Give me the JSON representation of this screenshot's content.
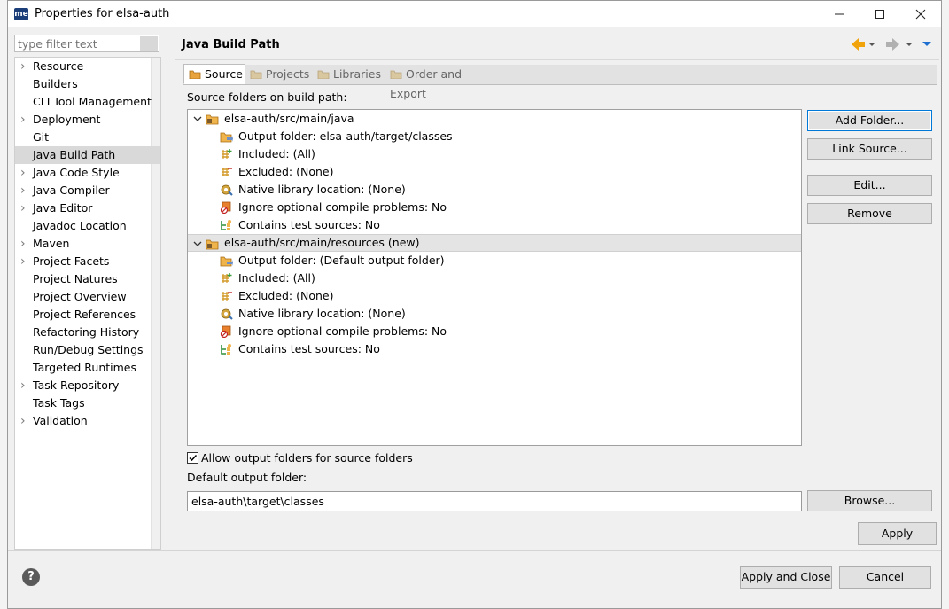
{
  "window": {
    "app_icon": "me",
    "title": "Properties for elsa-auth",
    "minimize_icon": "minimize-icon",
    "maximize_icon": "maximize-icon",
    "close_icon": "close-icon"
  },
  "filter": {
    "placeholder": "type filter text"
  },
  "nav": {
    "items": [
      {
        "label": "Resource",
        "expandable": true
      },
      {
        "label": "Builders",
        "expandable": false
      },
      {
        "label": "CLI Tool Management",
        "expandable": false
      },
      {
        "label": "Deployment",
        "expandable": true
      },
      {
        "label": "Git",
        "expandable": false
      },
      {
        "label": "Java Build Path",
        "expandable": false,
        "selected": true
      },
      {
        "label": "Java Code Style",
        "expandable": true
      },
      {
        "label": "Java Compiler",
        "expandable": true
      },
      {
        "label": "Java Editor",
        "expandable": true
      },
      {
        "label": "Javadoc Location",
        "expandable": false
      },
      {
        "label": "Maven",
        "expandable": true
      },
      {
        "label": "Project Facets",
        "expandable": true
      },
      {
        "label": "Project Natures",
        "expandable": false
      },
      {
        "label": "Project Overview",
        "expandable": false
      },
      {
        "label": "Project References",
        "expandable": false
      },
      {
        "label": "Refactoring History",
        "expandable": false
      },
      {
        "label": "Run/Debug Settings",
        "expandable": false
      },
      {
        "label": "Targeted Runtimes",
        "expandable": false
      },
      {
        "label": "Task Repository",
        "expandable": true
      },
      {
        "label": "Task Tags",
        "expandable": false
      },
      {
        "label": "Validation",
        "expandable": true
      }
    ]
  },
  "page": {
    "title": "Java Build Path",
    "tabs": [
      {
        "label": "Source",
        "active": true
      },
      {
        "label": "Projects",
        "active": false
      },
      {
        "label": "Libraries",
        "active": false
      },
      {
        "label": "Order and Export",
        "active": false
      }
    ],
    "source_label": "Source folders on build path:",
    "tree": [
      {
        "text": "elsa-auth/src/main/java",
        "level": 0,
        "icon": "package-folder-icon",
        "expanded": true
      },
      {
        "text": "Output folder: elsa-auth/target/classes",
        "level": 1,
        "icon": "output-folder-icon"
      },
      {
        "text": "Included: (All)",
        "level": 1,
        "icon": "inclusion-filter-icon"
      },
      {
        "text": "Excluded: (None)",
        "level": 1,
        "icon": "exclusion-filter-icon"
      },
      {
        "text": "Native library location: (None)",
        "level": 1,
        "icon": "native-library-icon"
      },
      {
        "text": "Ignore optional compile problems: No",
        "level": 1,
        "icon": "ignore-problems-icon"
      },
      {
        "text": "Contains test sources: No",
        "level": 1,
        "icon": "test-sources-icon"
      },
      {
        "text": "elsa-auth/src/main/resources (new)",
        "level": 0,
        "icon": "package-folder-icon",
        "expanded": true,
        "selected": true
      },
      {
        "text": "Output folder: (Default output folder)",
        "level": 1,
        "icon": "output-folder-icon"
      },
      {
        "text": "Included: (All)",
        "level": 1,
        "icon": "inclusion-filter-icon"
      },
      {
        "text": "Excluded: (None)",
        "level": 1,
        "icon": "exclusion-filter-icon"
      },
      {
        "text": "Native library location: (None)",
        "level": 1,
        "icon": "native-library-icon"
      },
      {
        "text": "Ignore optional compile problems: No",
        "level": 1,
        "icon": "ignore-problems-icon"
      },
      {
        "text": "Contains test sources: No",
        "level": 1,
        "icon": "test-sources-icon"
      }
    ],
    "buttons": {
      "add_folder": "Add Folder...",
      "link_source": "Link Source...",
      "edit": "Edit...",
      "remove": "Remove",
      "browse": "Browse...",
      "apply": "Apply"
    },
    "allow_output_label": "Allow output folders for source folders",
    "allow_output_checked": true,
    "default_output_label": "Default output folder:",
    "default_output_value": "elsa-auth\\target\\classes"
  },
  "footer": {
    "help_icon": "help-icon",
    "apply_close": "Apply and Close",
    "cancel": "Cancel"
  },
  "colors": {
    "accent": "#0078d7",
    "nav_selected": "#d9d9d9",
    "back_arrow": "#f0a30a"
  }
}
